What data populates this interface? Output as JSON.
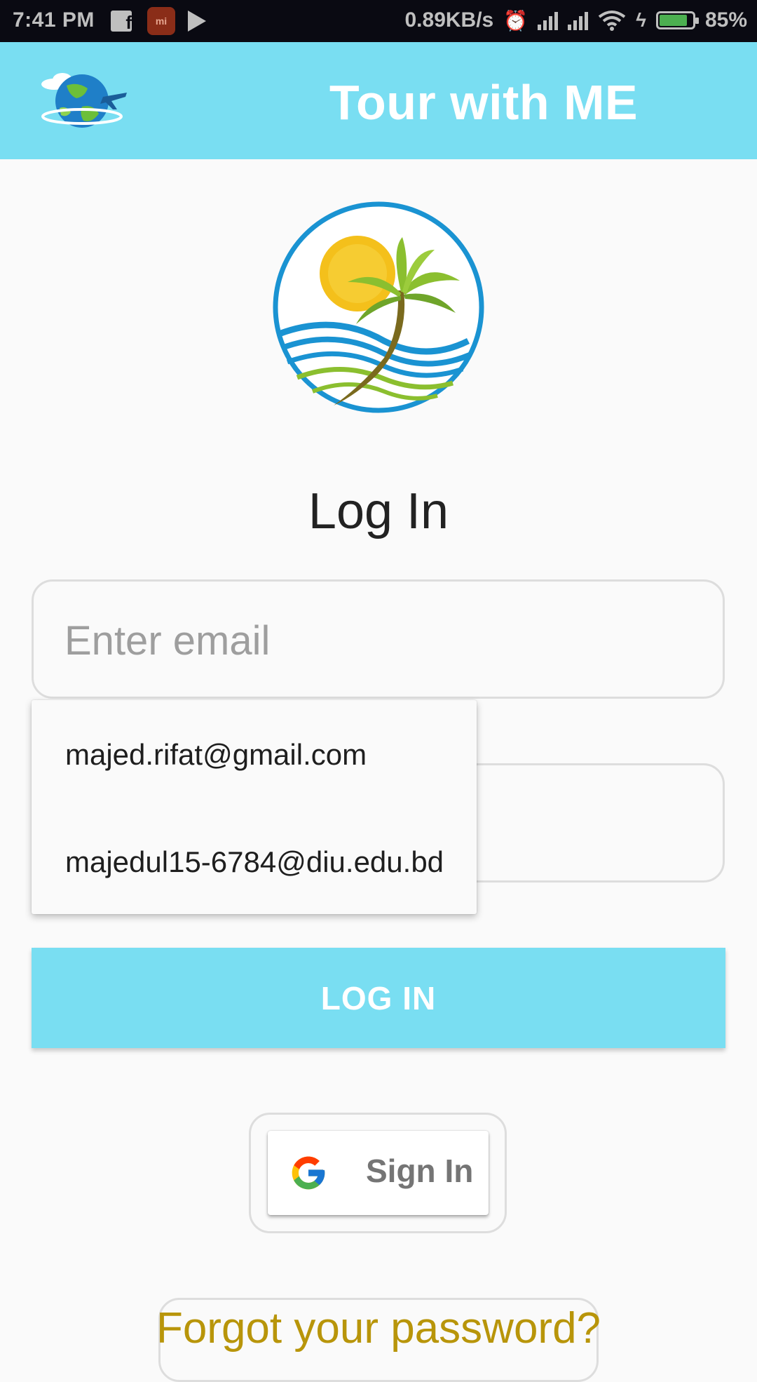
{
  "status_bar": {
    "time": "7:41 PM",
    "net_speed": "0.89KB/s",
    "battery_percent": "85%",
    "battery_level": 0.85,
    "icons": [
      "facebook-icon",
      "mi-icon",
      "play-store-icon",
      "alarm-icon",
      "signal-icon",
      "wifi-icon",
      "charging-icon",
      "battery-icon"
    ]
  },
  "app_bar": {
    "title": "Tour with ME",
    "logo_icon": "globe-plane-icon"
  },
  "main": {
    "logo_icon": "palm-beach-logo",
    "heading": "Log In",
    "email_field": {
      "placeholder": "Enter email",
      "value": ""
    },
    "password_field": {
      "placeholder": "",
      "value": ""
    },
    "autocomplete": {
      "items": [
        "majed.rifat@gmail.com",
        "majedul15-6784@diu.edu.bd"
      ]
    },
    "login_button": "LOG IN",
    "google_button": {
      "label": "Sign In",
      "icon": "google-g-icon"
    },
    "forgot_link": "Forgot your password?"
  },
  "colors": {
    "accent": "#79def2",
    "link": "#b8950a",
    "status_bar": "#0a0a12"
  }
}
